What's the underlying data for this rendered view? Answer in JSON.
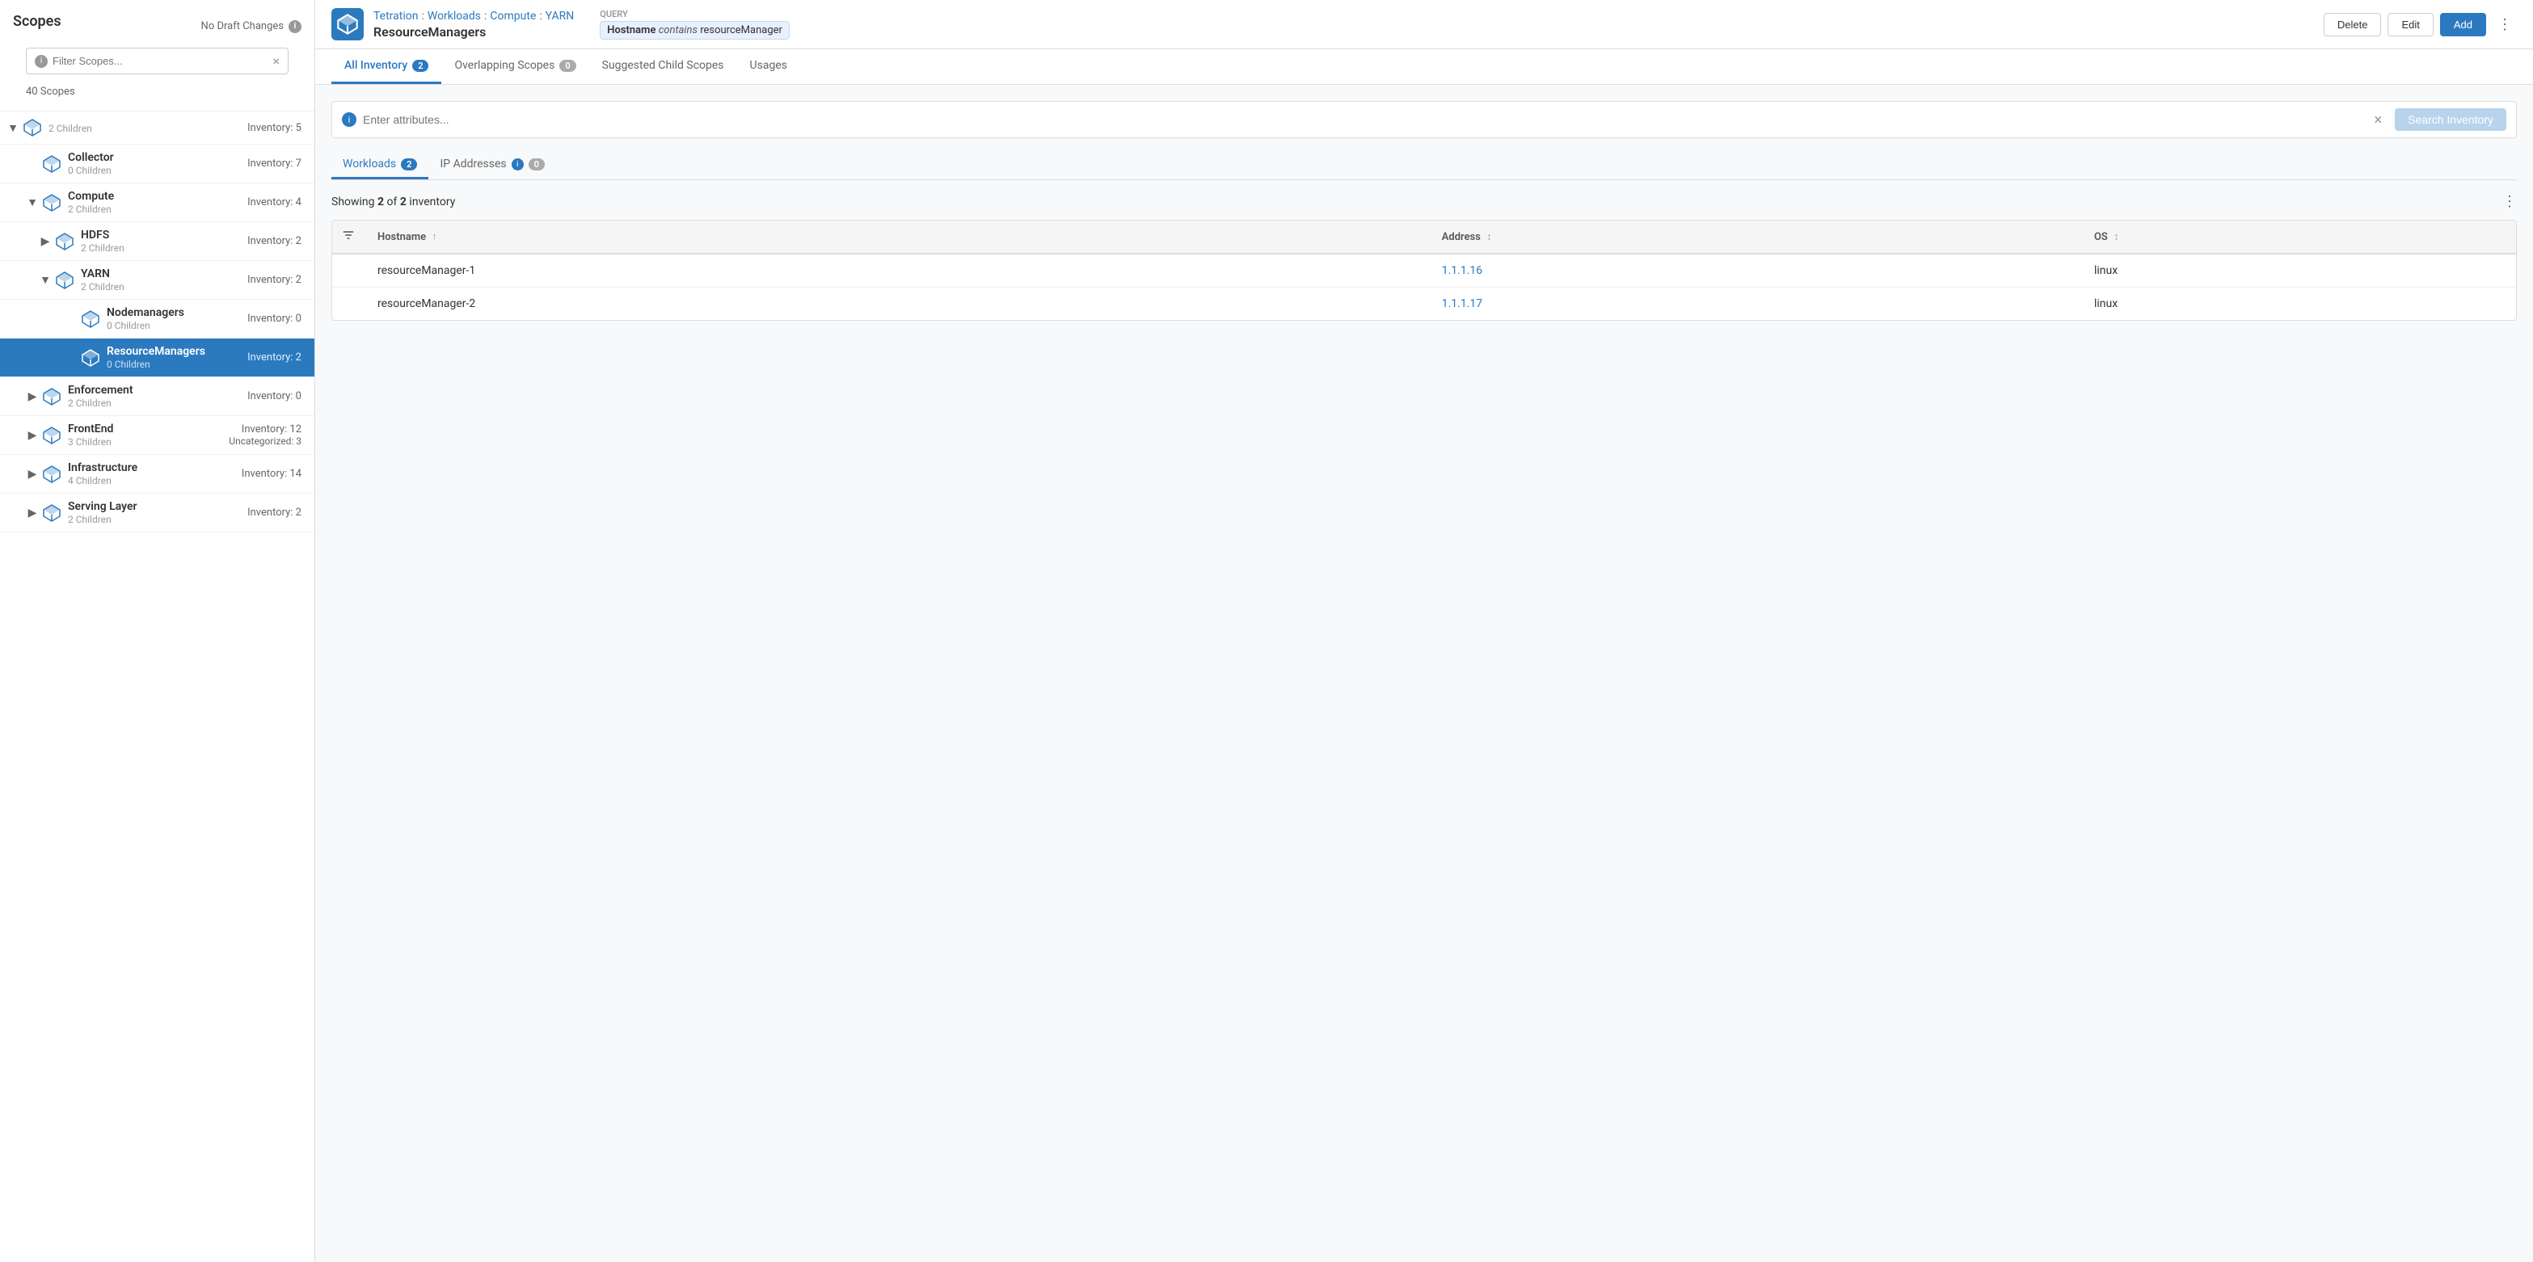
{
  "sidebar": {
    "title": "Scopes",
    "draft_notice": "No Draft Changes",
    "filter_placeholder": "Filter Scopes...",
    "scope_count": "40 Scopes",
    "scopes": [
      {
        "id": "scope-1",
        "name": "",
        "children_label": "2 Children",
        "inventory": "Inventory: 5",
        "level": 0,
        "expanded": true,
        "has_chevron": true,
        "chevron_direction": "down"
      },
      {
        "id": "collector",
        "name": "Collector",
        "children_label": "0 Children",
        "inventory": "Inventory: 7",
        "level": 1,
        "expanded": false,
        "has_chevron": false
      },
      {
        "id": "compute",
        "name": "Compute",
        "children_label": "2 Children",
        "inventory": "Inventory: 4",
        "level": 1,
        "expanded": true,
        "has_chevron": true,
        "chevron_direction": "down"
      },
      {
        "id": "hdfs",
        "name": "HDFS",
        "children_label": "2 Children",
        "inventory": "Inventory: 2",
        "level": 2,
        "expanded": false,
        "has_chevron": true,
        "chevron_direction": "right"
      },
      {
        "id": "yarn",
        "name": "YARN",
        "children_label": "2 Children",
        "inventory": "Inventory: 2",
        "level": 2,
        "expanded": true,
        "has_chevron": true,
        "chevron_direction": "down"
      },
      {
        "id": "nodemanagers",
        "name": "Nodemanagers",
        "children_label": "0 Children",
        "inventory": "Inventory: 0",
        "level": 3,
        "expanded": false,
        "has_chevron": false
      },
      {
        "id": "resourcemanagers",
        "name": "ResourceManagers",
        "children_label": "0 Children",
        "inventory": "Inventory: 2",
        "level": 3,
        "expanded": false,
        "has_chevron": false,
        "active": true
      },
      {
        "id": "enforcement",
        "name": "Enforcement",
        "children_label": "2 Children",
        "inventory": "Inventory: 0",
        "level": 1,
        "expanded": false,
        "has_chevron": true,
        "chevron_direction": "right"
      },
      {
        "id": "frontend",
        "name": "FrontEnd",
        "children_label": "3 Children",
        "inventory": "Inventory: 12",
        "inventory2": "Uncategorized: 3",
        "level": 1,
        "expanded": false,
        "has_chevron": true,
        "chevron_direction": "right"
      },
      {
        "id": "infrastructure",
        "name": "Infrastructure",
        "children_label": "4 Children",
        "inventory": "Inventory: 14",
        "level": 1,
        "expanded": false,
        "has_chevron": true,
        "chevron_direction": "right"
      },
      {
        "id": "serving-layer",
        "name": "Serving Layer",
        "children_label": "2 Children",
        "inventory": "Inventory: 2",
        "level": 1,
        "expanded": false,
        "has_chevron": true,
        "chevron_direction": "right"
      }
    ]
  },
  "topbar": {
    "breadcrumb": [
      "Tetration",
      "Workloads",
      "Compute",
      "YARN"
    ],
    "scope_name": "ResourceManagers",
    "query_label": "Query",
    "query_hostname_label": "Hostname",
    "query_operator": "contains",
    "query_value": "resourceManager",
    "delete_label": "Delete",
    "edit_label": "Edit",
    "add_label": "Add"
  },
  "tabs": [
    {
      "id": "all-inventory",
      "label": "All Inventory",
      "badge": "2",
      "active": true
    },
    {
      "id": "overlapping-scopes",
      "label": "Overlapping Scopes",
      "badge": "0",
      "active": false
    },
    {
      "id": "suggested-child-scopes",
      "label": "Suggested Child Scopes",
      "active": false
    },
    {
      "id": "usages",
      "label": "Usages",
      "active": false
    }
  ],
  "search": {
    "placeholder": "Enter attributes...",
    "button_label": "Search Inventory"
  },
  "sub_tabs": [
    {
      "id": "workloads",
      "label": "Workloads",
      "badge": "2",
      "active": true
    },
    {
      "id": "ip-addresses",
      "label": "IP Addresses",
      "badge": "0",
      "active": false
    }
  ],
  "inventory": {
    "showing_text": "Showing",
    "shown_count": "2",
    "of_text": "of",
    "total_count": "2",
    "suffix": "inventory",
    "columns": [
      {
        "id": "hostname",
        "label": "Hostname",
        "sort": "asc"
      },
      {
        "id": "address",
        "label": "Address",
        "sort": "both"
      },
      {
        "id": "os",
        "label": "OS",
        "sort": "both"
      }
    ],
    "rows": [
      {
        "hostname": "resourceManager-1",
        "address": "1.1.1.16",
        "os": "linux"
      },
      {
        "hostname": "resourceManager-2",
        "address": "1.1.1.17",
        "os": "linux"
      }
    ]
  }
}
